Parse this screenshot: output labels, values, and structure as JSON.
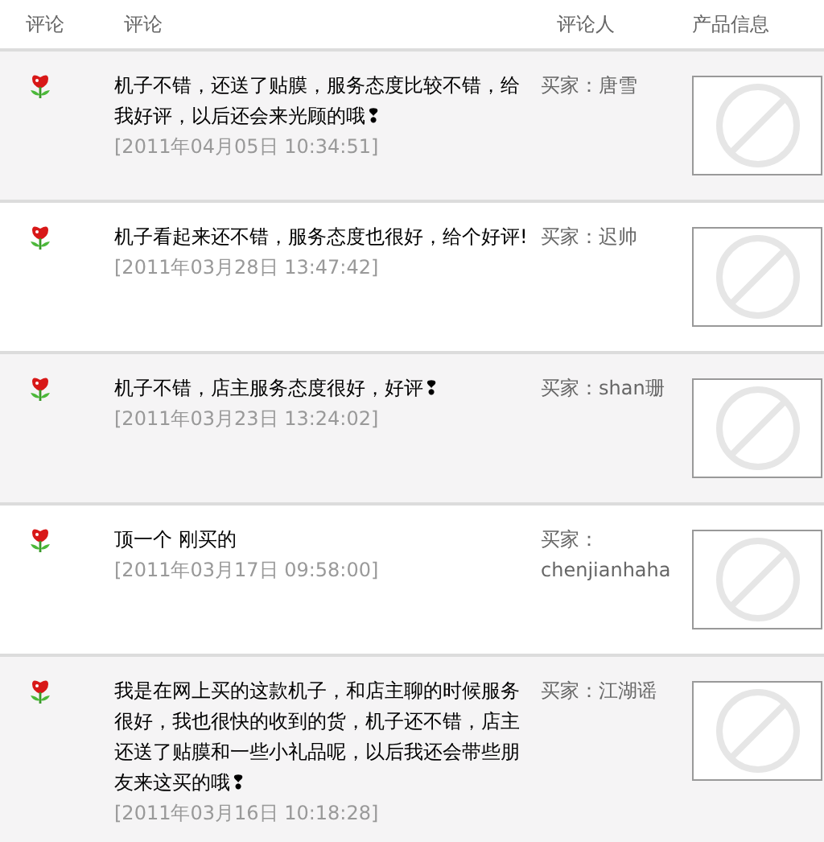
{
  "table": {
    "columns": [
      "评论",
      "评论",
      "评论人",
      "产品信息"
    ],
    "rows": [
      {
        "comment": "机子不错，还送了贴膜，服务态度比较不错，给我好评，以后还会来光顾的哦❢",
        "date": "[2011年04月05日 10:34:51]",
        "reviewer": "买家：唐雪"
      },
      {
        "comment": "机子看起来还不错，服务态度也很好，给个好评!",
        "date": "[2011年03月28日 13:47:42]",
        "reviewer": "买家：迟帅"
      },
      {
        "comment": "机子不错，店主服务态度很好，好评❢",
        "date": "[2011年03月23日 13:24:02]",
        "reviewer": "买家：shan珊"
      },
      {
        "comment": "顶一个 刚买的",
        "date": "[2011年03月17日 09:58:00]",
        "reviewer": "买家：chenjianhaha"
      },
      {
        "comment": "我是在网上买的这款机子，和店主聊的时候服务很好，我也很快的收到的货，机子还不错，店主还送了贴膜和一些小礼品呢，以后我还会带些朋友来这买的哦❢",
        "date": "[2011年03月16日 10:18:28]",
        "reviewer": "买家：江湖谣"
      }
    ]
  }
}
